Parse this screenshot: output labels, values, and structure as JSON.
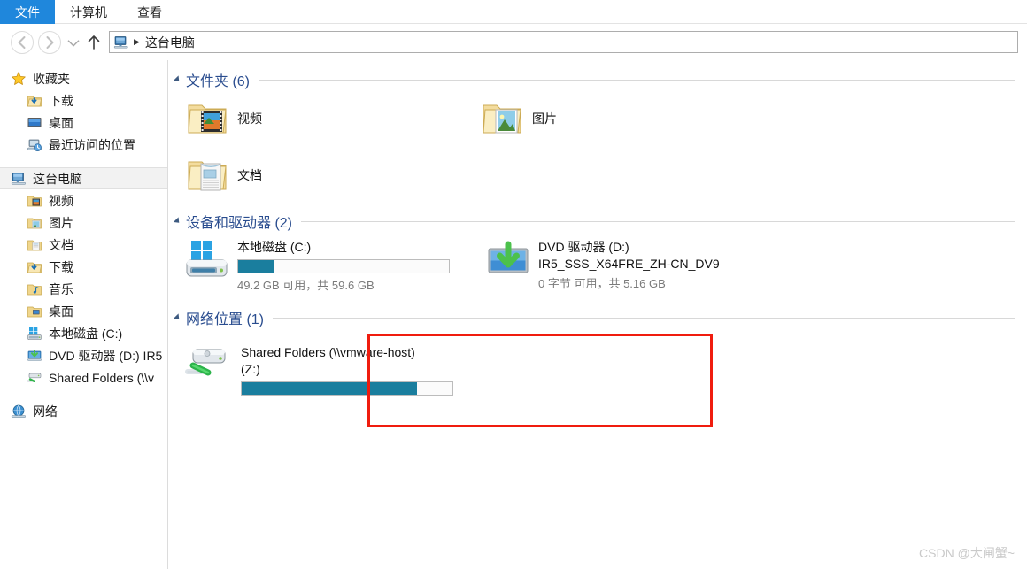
{
  "ribbon": {
    "tabs": [
      {
        "label": "文件",
        "active": true
      },
      {
        "label": "计算机",
        "active": false
      },
      {
        "label": "查看",
        "active": false
      }
    ]
  },
  "navbar": {
    "back_glyph": "⇐",
    "forward_glyph": "⇒",
    "recent_glyph": "▾",
    "up_glyph": "↑",
    "address_icon": "this-pc-icon",
    "address_separator": "▶",
    "address_text": "这台电脑"
  },
  "sidebar": {
    "items": [
      {
        "label": "收藏夹",
        "icon": "star-icon",
        "indent": 0,
        "selected": false
      },
      {
        "label": "下载",
        "icon": "downloads-folder-icon",
        "indent": 1,
        "selected": false
      },
      {
        "label": "桌面",
        "icon": "desktop-icon",
        "indent": 1,
        "selected": false
      },
      {
        "label": "最近访问的位置",
        "icon": "recent-places-icon",
        "indent": 1,
        "selected": false
      },
      {
        "label": "这台电脑",
        "icon": "this-pc-icon",
        "indent": 0,
        "selected": true
      },
      {
        "label": "视频",
        "icon": "videos-folder-icon",
        "indent": 1,
        "selected": false
      },
      {
        "label": "图片",
        "icon": "pictures-folder-icon",
        "indent": 1,
        "selected": false
      },
      {
        "label": "文档",
        "icon": "documents-folder-icon",
        "indent": 1,
        "selected": false
      },
      {
        "label": "下载",
        "icon": "downloads-folder-icon",
        "indent": 1,
        "selected": false
      },
      {
        "label": "音乐",
        "icon": "music-folder-icon",
        "indent": 1,
        "selected": false
      },
      {
        "label": "桌面",
        "icon": "desktop-folder-icon",
        "indent": 1,
        "selected": false
      },
      {
        "label": "本地磁盘 (C:)",
        "icon": "windows-drive-icon",
        "indent": 1,
        "selected": false
      },
      {
        "label": "DVD 驱动器 (D:) IR5",
        "icon": "dvd-drive-icon",
        "indent": 1,
        "selected": false
      },
      {
        "label": "Shared Folders (\\\\v",
        "icon": "network-drive-icon",
        "indent": 1,
        "selected": false
      },
      {
        "label": "网络",
        "icon": "network-icon",
        "indent": 0,
        "selected": false
      }
    ]
  },
  "content": {
    "groups": [
      {
        "title": "文件夹 (6)",
        "kind": "folders",
        "items": [
          {
            "label": "视频",
            "icon": "videos-folder-icon"
          },
          {
            "label": "图片",
            "icon": "pictures-folder-icon"
          },
          {
            "label": "文档",
            "icon": "documents-folder-icon"
          }
        ]
      },
      {
        "title": "设备和驱动器 (2)",
        "kind": "drives",
        "items": [
          {
            "name": "本地磁盘 (C:)",
            "name2": "",
            "icon": "windows-drive-icon",
            "bar_percent": 17,
            "sub": "49.2 GB 可用，共 59.6 GB"
          },
          {
            "name": "DVD 驱动器 (D:)",
            "name2": "IR5_SSS_X64FRE_ZH-CN_DV9",
            "icon": "dvd-drive-icon",
            "bar_percent": 0,
            "sub": "0 字节 可用，共 5.16 GB"
          }
        ]
      },
      {
        "title": "网络位置 (1)",
        "kind": "network",
        "items": [
          {
            "name": "Shared Folders (\\\\vmware-host)",
            "name2": "(Z:)",
            "icon": "network-drive-icon",
            "bar_percent": 83,
            "sub": ""
          }
        ]
      }
    ],
    "highlight_color": "#f01c0e",
    "bar_fill_color": "#1a7e9e"
  },
  "watermark": {
    "text": "CSDN @大闸蟹~"
  }
}
